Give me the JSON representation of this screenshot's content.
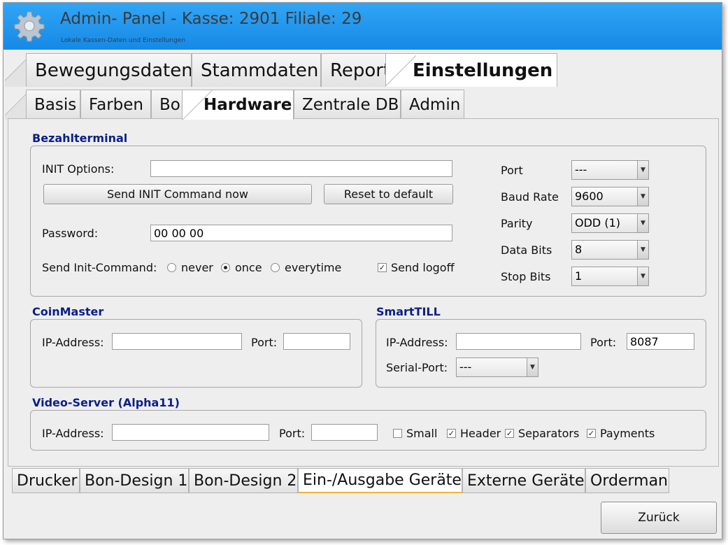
{
  "window": {
    "title": "Admin- Panel - Kasse: 2901 Filiale: 29",
    "subtitle": "Lokale Kassen-Daten und Einstellungen",
    "icon": "gear-icon"
  },
  "main_tabs": [
    "Bewegungsdaten",
    "Stammdaten",
    "Reporte",
    "Einstellungen"
  ],
  "sub_tabs": [
    "Basis",
    "Farben",
    "Bon",
    "Hardware",
    "Zentrale DB",
    "Admin"
  ],
  "bezahlterminal": {
    "title": "Bezahlterminal",
    "init_label": "INIT Options:",
    "init_value": "",
    "send_init_button": "Send INIT Command now",
    "reset_button": "Reset to default",
    "password_label": "Password:",
    "password_value": "00 00 00",
    "send_mode_label": "Send Init-Command:",
    "send_modes": [
      "never",
      "once",
      "everytime"
    ],
    "send_mode_selected": "once",
    "send_logoff_label": "Send logoff",
    "send_logoff_checked": true,
    "port_label": "Port",
    "port_value": "---",
    "baud_label": "Baud Rate",
    "baud_value": "9600",
    "parity_label": "Parity",
    "parity_value": "ODD (1)",
    "databits_label": "Data Bits",
    "databits_value": "8",
    "stopbits_label": "Stop Bits",
    "stopbits_value": "1"
  },
  "coinmaster": {
    "title": "CoinMaster",
    "ip_label": "IP-Address:",
    "ip_value": "",
    "port_label": "Port:",
    "port_value": ""
  },
  "smarttill": {
    "title": "SmartTILL",
    "ip_label": "IP-Address:",
    "ip_value": "",
    "port_label": "Port:",
    "port_value": "8087",
    "serial_label": "Serial-Port:",
    "serial_value": "---"
  },
  "videoserver": {
    "title": "Video-Server (Alpha11)",
    "ip_label": "IP-Address:",
    "ip_value": "",
    "port_label": "Port:",
    "port_value": "",
    "small_label": "Small",
    "small_checked": false,
    "header_label": "Header",
    "header_checked": true,
    "separators_label": "Separators",
    "separators_checked": true,
    "payments_label": "Payments",
    "payments_checked": true
  },
  "bottom_tabs": [
    "Drucker",
    "Bon-Design 1",
    "Bon-Design 2",
    "Ein-/Ausgabe Geräte",
    "Externe Geräte",
    "Orderman"
  ],
  "back_button": "Zurück",
  "colors": {
    "titlebar": "#1e90ea",
    "section_title": "#0a1e8a",
    "selected_tab_underline": "#f2b23a"
  }
}
